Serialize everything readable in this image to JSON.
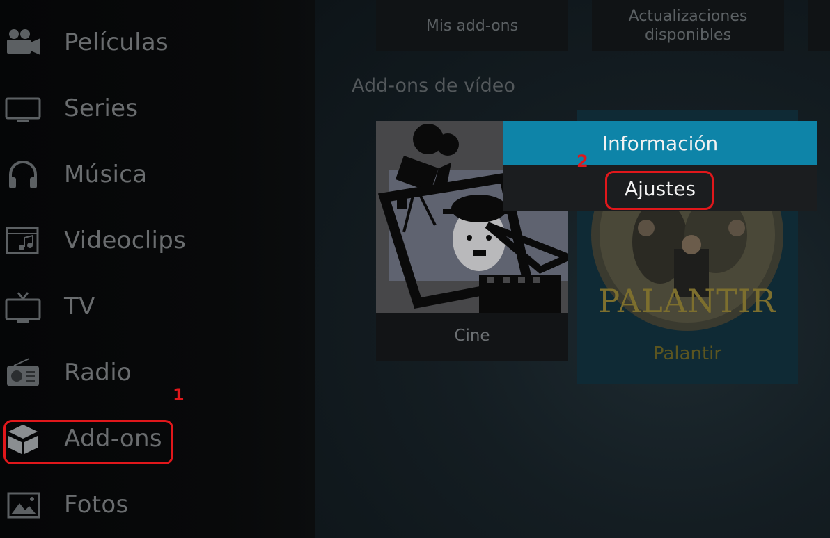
{
  "sidebar": {
    "items": [
      {
        "label": "Películas",
        "icon": "movie-camera-icon"
      },
      {
        "label": "Series",
        "icon": "tv-icon"
      },
      {
        "label": "Música",
        "icon": "headphones-icon"
      },
      {
        "label": "Videoclips",
        "icon": "music-video-icon"
      },
      {
        "label": "TV",
        "icon": "tv-antenna-icon"
      },
      {
        "label": "Radio",
        "icon": "radio-icon"
      },
      {
        "label": "Add-ons",
        "icon": "box-icon"
      },
      {
        "label": "Fotos",
        "icon": "photo-icon"
      }
    ]
  },
  "top_tiles": {
    "my_addons": "Mis add-ons",
    "updates": "Actualizaciones\ndisponibles"
  },
  "section_title": "Add-ons de vídeo",
  "addons": {
    "cine": {
      "label": "Cine"
    },
    "palantir": {
      "label": "Palantir",
      "logo_text": "PALANTIR"
    }
  },
  "context_menu": {
    "items": [
      "Información",
      "Ajustes"
    ],
    "focused_index": 0
  },
  "annotations": {
    "marker_1": "1",
    "marker_2": "2"
  },
  "colors": {
    "focus_blue": "#0e84a8",
    "annotation_red": "#e0171b",
    "sidebar_text": "#6a6d6f"
  }
}
